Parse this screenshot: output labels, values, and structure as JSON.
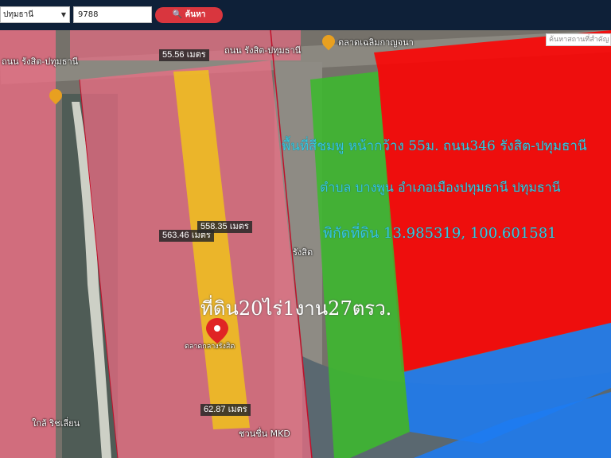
{
  "toolbar": {
    "province_select": "ปทุมธานี",
    "parcel_input": "9788",
    "search_button": "ค้นหา"
  },
  "map": {
    "search_placeholder": "ค้นหาสถานที่สำคัญ",
    "road_labels": [
      "ถนน รังสิต-ปทุมธานี",
      "ถนน รังสิต-ปทุมธานี",
      "ตลาดเฉลิมกาญจนา",
      "รังสิต",
      "ชวนชื่น MKD",
      "ใกล้ ริชเลี่ยน"
    ],
    "pin_caption": "ตลาดกลางรังสิต",
    "poi_colors": {
      "food": "#e8a020",
      "location_pin": "#e02424"
    }
  },
  "measurements": {
    "top_width": "55.56 เมตร",
    "left_length": "563.46 เมตร",
    "right_length": "558.35 เมตร",
    "bottom_width": "62.87 เมตร"
  },
  "annotation": {
    "line1": "พื้นที่สีชมพู หน้ากว้าง 55ม. ถนน346 รังสิต-ปทุมธานี",
    "line2": "ตำบล บางพูน อำเภอเมืองปทุมธานี ปทุมธานี",
    "line3": "พิกัดที่ดิน 13.985319, 100.601581",
    "land_size": "ที่ดิน20ไร่1งาน27ตรว."
  },
  "colors": {
    "zone_pink": "#f06c84",
    "zone_red": "#ff0000",
    "zone_green": "#3cb82e",
    "zone_blue": "#1e7bf0",
    "parcel_yellow": "#f2c418",
    "annotation_cyan": "#39c8e0",
    "search_red": "#d9363e"
  }
}
